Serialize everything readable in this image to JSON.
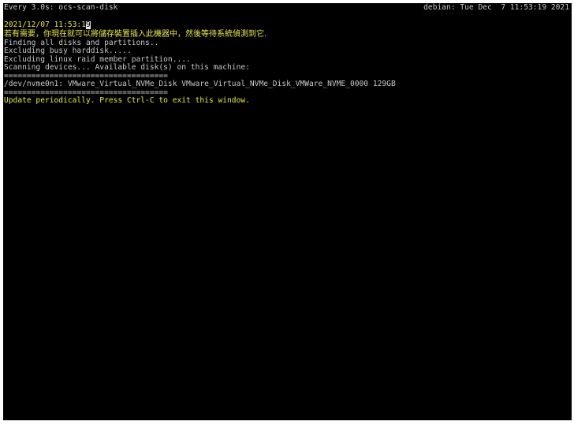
{
  "header": {
    "watch_command": "Every 3.0s: ocs-scan-disk",
    "host_time": "debian: Tue Dec  7 11:53:19 2021"
  },
  "output": {
    "timestamp": "2021/12/07 11:53:1",
    "cursor_char": "9",
    "chinese_prompt": "若有需要，你現在就可以將儲存裝置插入此機器中，然後等待系統偵測到它.",
    "lines": [
      "Finding all disks and partitions..",
      "Excluding busy harddisk.....",
      "Excluding linux raid member partition....",
      "Scanning devices... Available disk(s) on this machine:"
    ],
    "separator": "====================================",
    "disk_entry": "/dev/nvme0n1: VMware_Virtual_NVMe_Disk VMware_Virtual_NVMe_Disk_VMWare_NVME_0000 129GB",
    "footer_message": "Update periodically. Press Ctrl-C to exit this window."
  },
  "colors": {
    "background": "#000000",
    "text": "#c8c8c8",
    "highlight": "#e8e84a"
  }
}
